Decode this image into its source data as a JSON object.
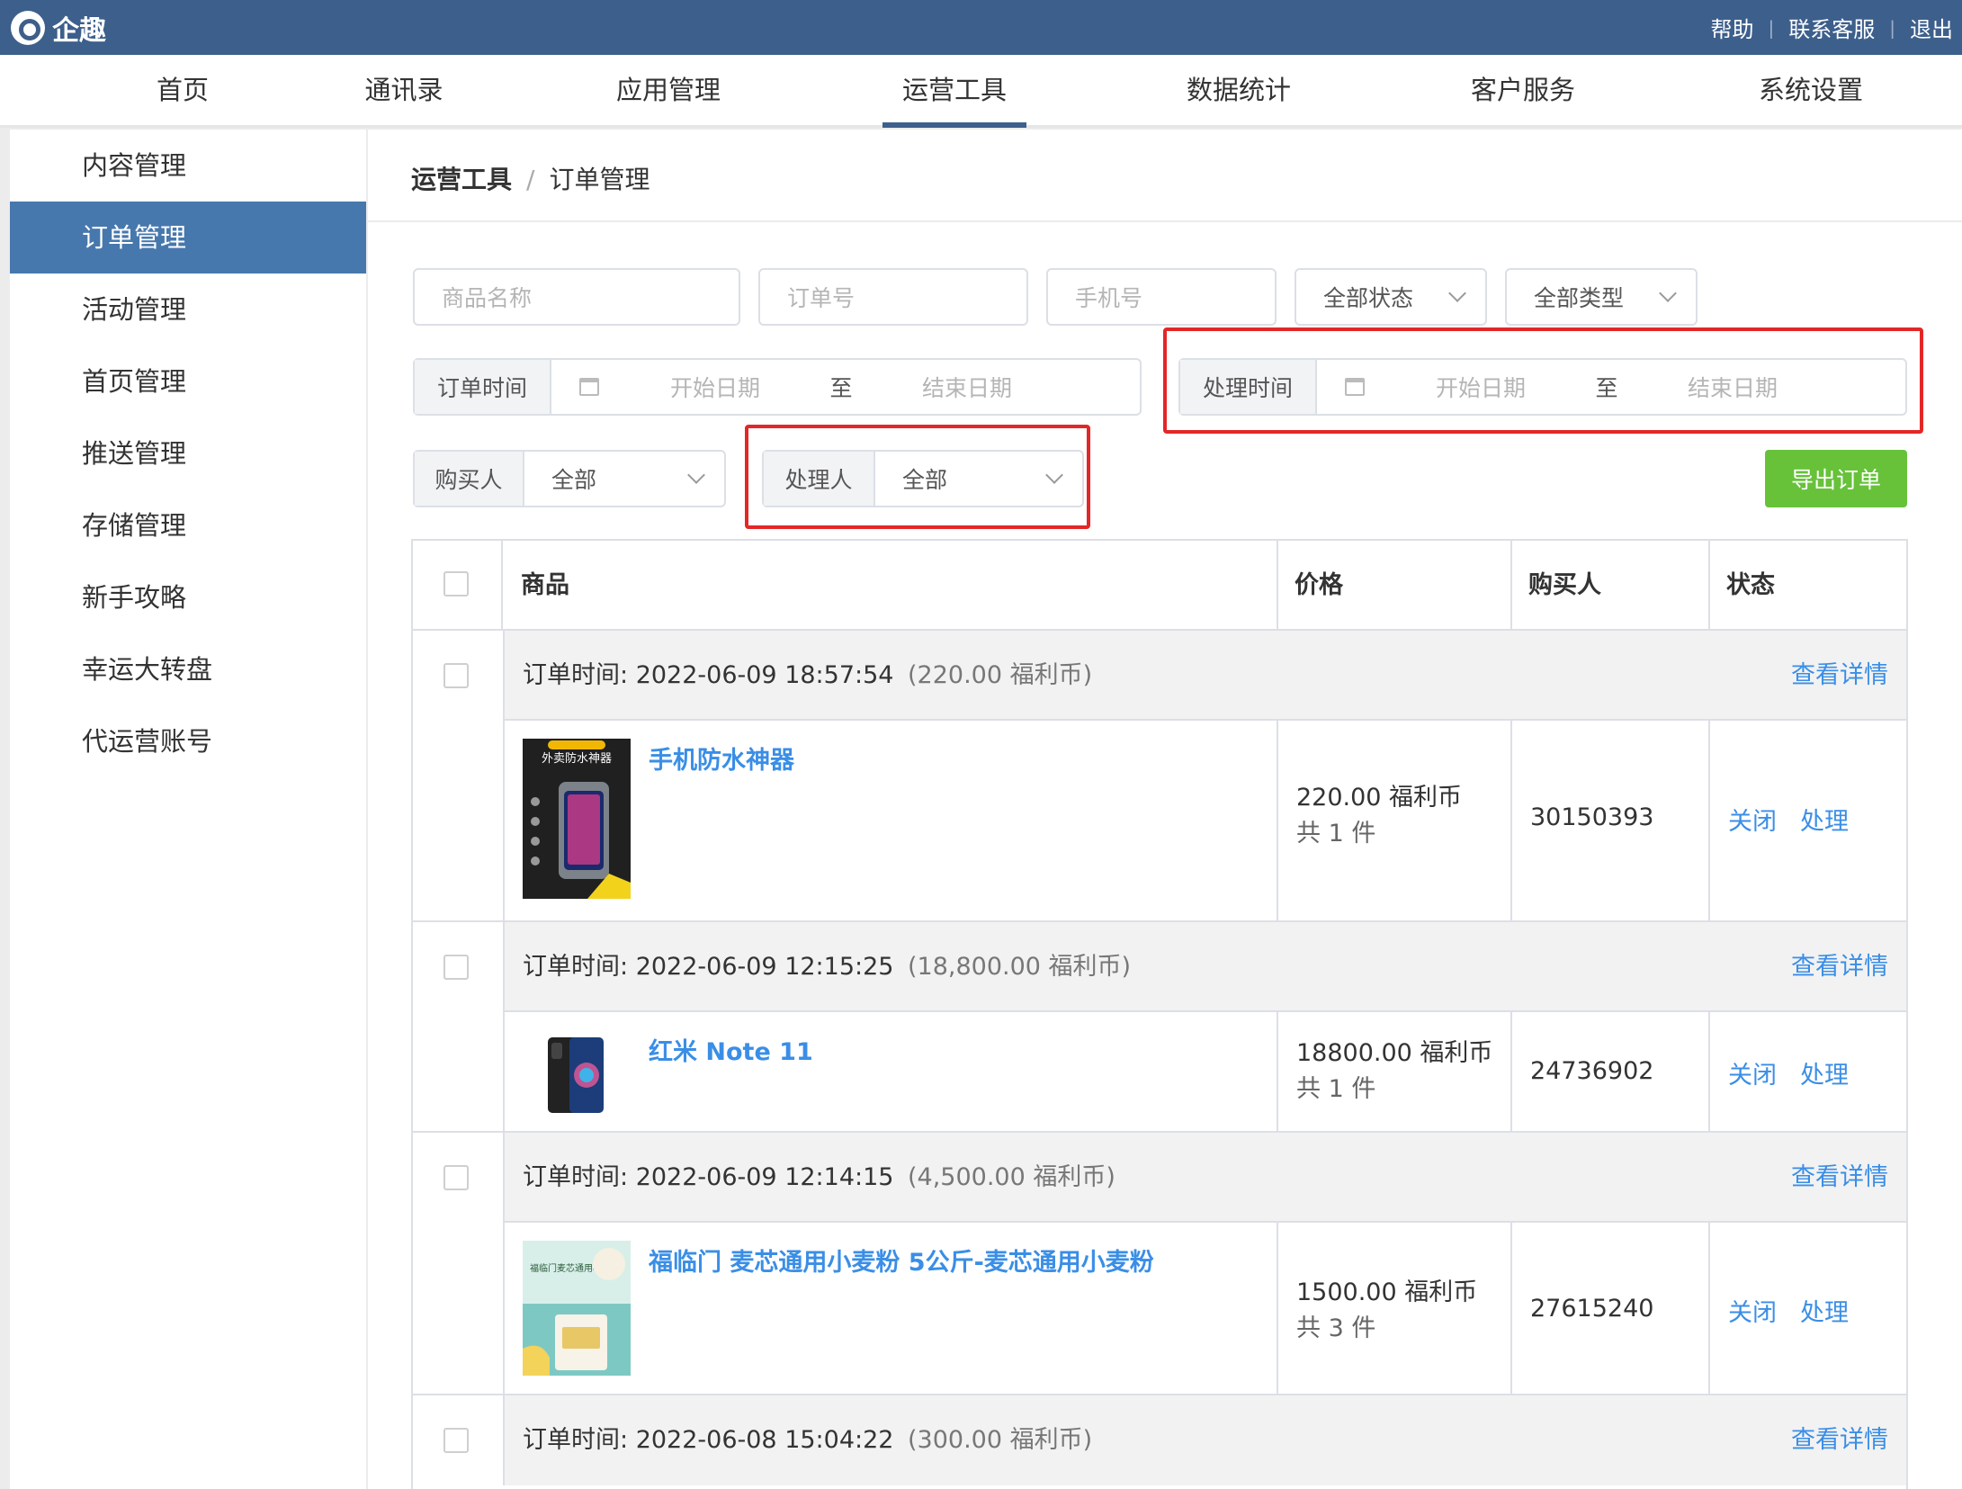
{
  "app": {
    "name": "企趣"
  },
  "topbar": {
    "links": [
      "帮助",
      "联系客服",
      "退出"
    ]
  },
  "nav": {
    "items": [
      "首页",
      "通讯录",
      "应用管理",
      "运营工具",
      "数据统计",
      "客户服务",
      "系统设置"
    ],
    "active": "运营工具"
  },
  "sidebar": {
    "items": [
      "内容管理",
      "订单管理",
      "活动管理",
      "首页管理",
      "推送管理",
      "存储管理",
      "新手攻略",
      "幸运大转盘",
      "代运营账号"
    ],
    "active": "订单管理"
  },
  "breadcrumb": {
    "root": "运营工具",
    "separator": "/",
    "current": "订单管理"
  },
  "filters": {
    "product_name_placeholder": "商品名称",
    "order_no_placeholder": "订单号",
    "phone_placeholder": "手机号",
    "status_select": "全部状态",
    "type_select": "全部类型",
    "order_time": {
      "label": "订单时间",
      "start": "开始日期",
      "to": "至",
      "end": "结束日期"
    },
    "process_time": {
      "label": "处理时间",
      "start": "开始日期",
      "to": "至",
      "end": "结束日期"
    },
    "buyer": {
      "label": "购买人",
      "value": "全部"
    },
    "handler": {
      "label": "处理人",
      "value": "全部"
    },
    "export_label": "导出订单"
  },
  "table": {
    "headers": {
      "product": "商品",
      "price": "价格",
      "buyer": "购买人",
      "status": "状态"
    },
    "orders": [
      {
        "time_label": "订单时间:",
        "time": "2022-06-09 18:57:54",
        "total": "(220.00 福利币)",
        "detail": "查看详情",
        "product": "手机防水神器",
        "price": "220.00 福利币",
        "qty": "共 1 件",
        "buyer": "30150393",
        "actions": [
          "关闭",
          "处理"
        ]
      },
      {
        "time_label": "订单时间:",
        "time": "2022-06-09 12:15:25",
        "total": "(18,800.00 福利币)",
        "detail": "查看详情",
        "product": "红米 Note 11",
        "price": "18800.00 福利币",
        "qty": "共 1 件",
        "buyer": "24736902",
        "actions": [
          "关闭",
          "处理"
        ]
      },
      {
        "time_label": "订单时间:",
        "time": "2022-06-09 12:14:15",
        "total": "(4,500.00 福利币)",
        "detail": "查看详情",
        "product": "福临门 麦芯通用小麦粉 5公斤-麦芯通用小麦粉",
        "price": "1500.00 福利币",
        "qty": "共 3 件",
        "buyer": "27615240",
        "actions": [
          "关闭",
          "处理"
        ]
      },
      {
        "time_label": "订单时间:",
        "time": "2022-06-08 15:04:22",
        "total": "(300.00 福利币)",
        "detail": "查看详情"
      }
    ]
  },
  "thumb_text": {
    "waterproof_title": "外卖防水神器",
    "flour_title": "福临门麦芯通用小麦粉"
  },
  "colors": {
    "header_bg": "#3d5f8c",
    "sidebar_active": "#4778ad",
    "link": "#3a8ee6",
    "export_btn": "#67c23a",
    "highlight_border": "#e32727"
  }
}
